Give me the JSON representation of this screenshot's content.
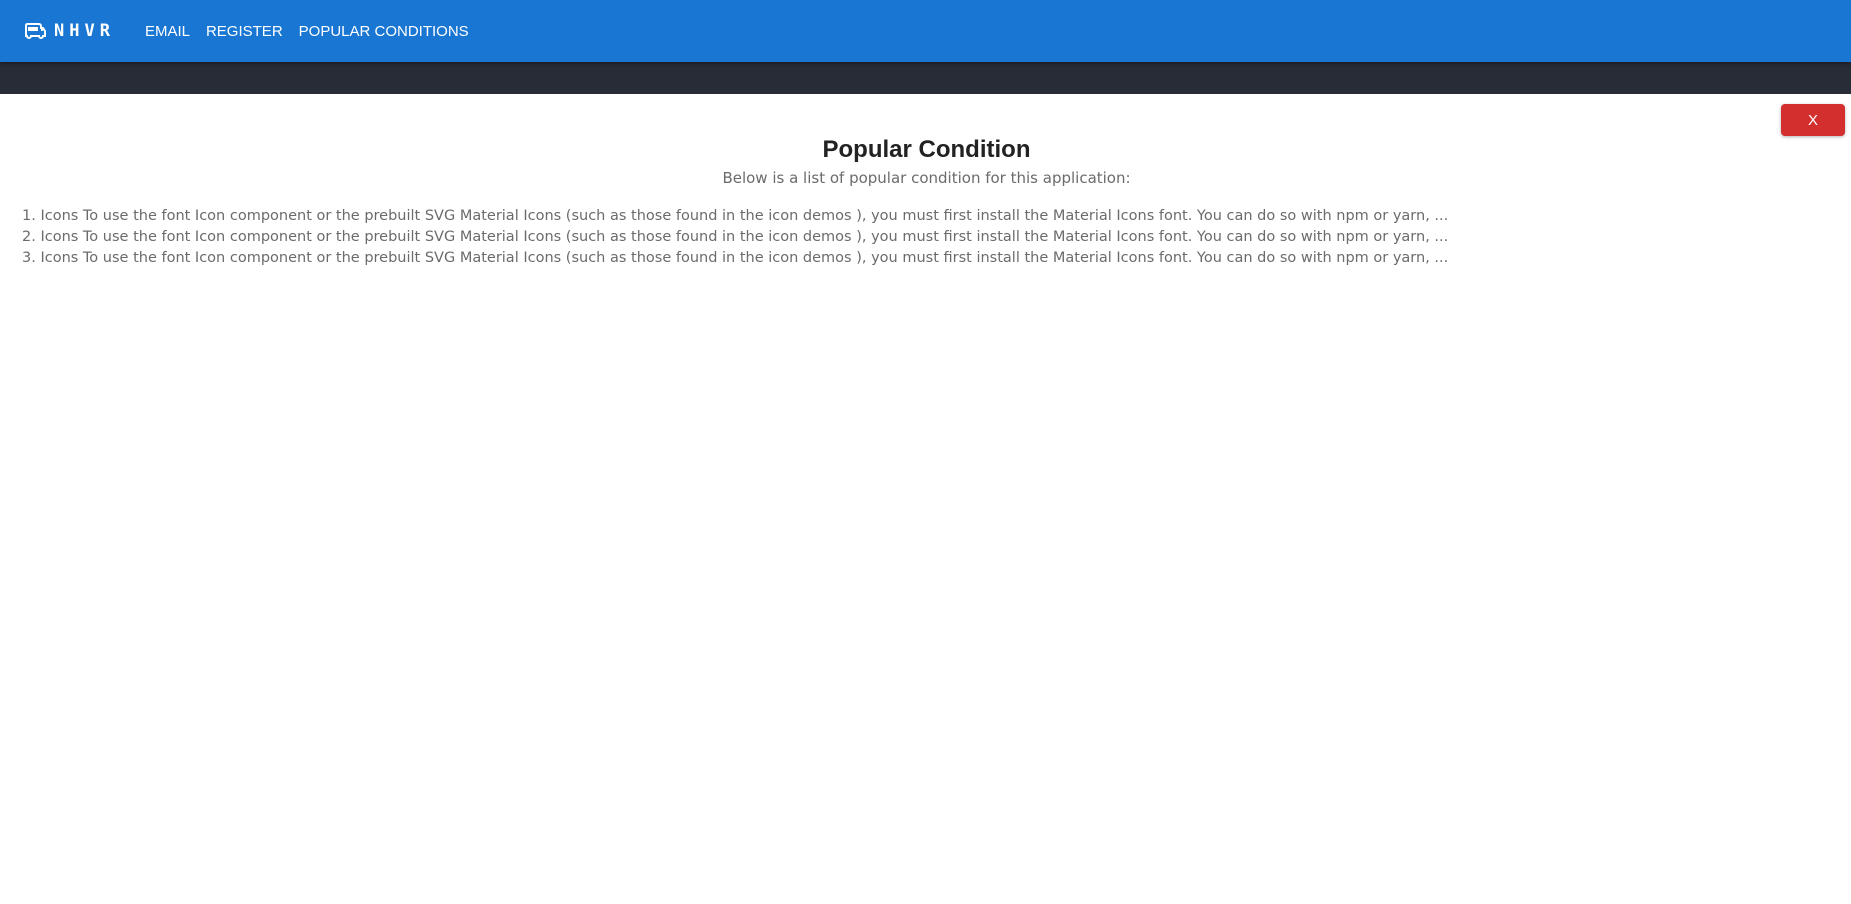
{
  "header": {
    "brand_icon": "bus-icon",
    "brand_text": "NHVR",
    "nav": [
      {
        "label": "EMAIL"
      },
      {
        "label": "REGISTER"
      },
      {
        "label": "POPULAR CONDITIONS"
      }
    ],
    "background_color": "#1976d2"
  },
  "dialog": {
    "close_label": "X",
    "close_color": "#d32f2f",
    "title": "Popular Condition",
    "subtitle": "Below is a list of popular condition for this application:",
    "conditions": [
      {
        "text": "1. Icons To use the font Icon component or the prebuilt SVG Material Icons (such as those found in the icon demos ), you must first install the Material Icons font. You can do so with npm or yarn, ..."
      },
      {
        "text": "2. Icons To use the font Icon component or the prebuilt SVG Material Icons (such as those found in the icon demos ), you must first install the Material Icons font. You can do so with npm or yarn, ..."
      },
      {
        "text": "3. Icons To use the font Icon component or the prebuilt SVG Material Icons (such as those found in the icon demos ), you must first install the Material Icons font. You can do so with npm or yarn, ..."
      }
    ]
  }
}
